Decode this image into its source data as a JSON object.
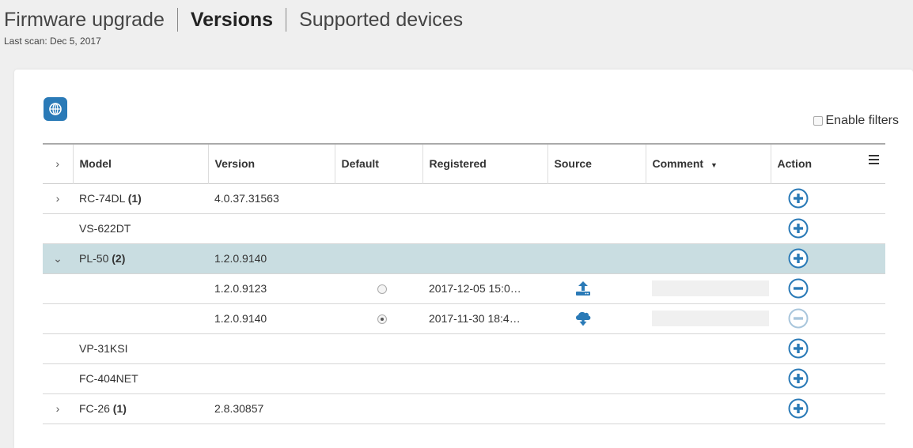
{
  "header": {
    "tabs": [
      {
        "label": "Firmware upgrade"
      },
      {
        "label": "Versions"
      },
      {
        "label": "Supported devices"
      }
    ],
    "last_scan": "Last scan: Dec 5, 2017"
  },
  "filters": {
    "label": "Enable filters"
  },
  "table": {
    "columns": [
      "Model",
      "Version",
      "Default",
      "Registered",
      "Source",
      "Comment",
      "Action"
    ],
    "rows": [
      {
        "expander": "›",
        "model": "RC-74DL",
        "count": "(1)",
        "version": "4.0.37.31563"
      },
      {
        "expander": "",
        "model": "VS-622DT",
        "count": "",
        "version": ""
      },
      {
        "expander": "⌄",
        "model": "PL-50",
        "count": "(2)",
        "version": "1.2.0.9140"
      },
      {
        "version": "1.2.0.9123",
        "default": false,
        "registered": "2017-12-05 15:0…",
        "source": "upload-icon"
      },
      {
        "version": "1.2.0.9140",
        "default": true,
        "registered": "2017-11-30 18:4…",
        "source": "cloud-download-icon"
      },
      {
        "expander": "",
        "model": "VP-31KSI",
        "count": "",
        "version": ""
      },
      {
        "expander": "",
        "model": "FC-404NET",
        "count": "",
        "version": ""
      },
      {
        "expander": "›",
        "model": "FC-26",
        "count": "(1)",
        "version": "2.8.30857"
      }
    ]
  },
  "colors": {
    "accent": "#2a7ab7",
    "selected_row": "#c9dde1",
    "disabled": "#a9c6dc"
  }
}
